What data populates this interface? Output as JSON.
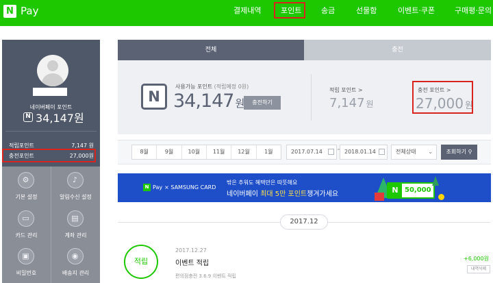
{
  "header": {
    "logo_letter": "N",
    "brand": "Pay",
    "nav": [
      "결제내역",
      "포인트",
      "송금",
      "선물함",
      "이벤트·쿠폰",
      "구매평·문의"
    ],
    "active_nav": "포인트"
  },
  "profile": {
    "point_label": "네이버페이 포인트",
    "total_points": "34,147원",
    "rows": [
      {
        "label": "적립포인트",
        "value": "7,147 원"
      },
      {
        "label": "충전포인트",
        "value": "27,000원"
      }
    ],
    "menu": [
      {
        "label": "기본 설정",
        "icon": "gear-icon"
      },
      {
        "label": "알림수신 설정",
        "icon": "bell-icon"
      },
      {
        "label": "카드 관리",
        "icon": "card-icon"
      },
      {
        "label": "계좌 관리",
        "icon": "bank-icon"
      },
      {
        "label": "비밀번호",
        "icon": "lock-icon"
      },
      {
        "label": "배송지 관리",
        "icon": "location-pin-icon"
      }
    ]
  },
  "tabs": [
    "전체",
    "충전"
  ],
  "summary": {
    "available_label": "사용가능 포인트",
    "available_sub": "(적립예정 0원)",
    "available_value": "34,147",
    "unit": "원",
    "charge_button": "충전하기",
    "accrued_label": "적립 포인트 >",
    "accrued_value": "7,147",
    "charged_label": "충전 포인트 >",
    "charged_value": "27,000"
  },
  "filter": {
    "months": [
      "8월",
      "9월",
      "10월",
      "11월",
      "12월",
      "1월"
    ],
    "date_from": "2017.07.14",
    "date_to": "2018.01.14",
    "tilde": "~",
    "status_select": "전체상태",
    "query_button": "조회하기"
  },
  "banner": {
    "brand": "Pay",
    "partner": "× SAMSUNG CARD",
    "line1": "밖은 추워도 혜택만은 따뜻해요",
    "line2_prefix": "네이버페이 ",
    "line2_highlight": "최대 5만 포인트",
    "line2_suffix": "챙겨가세요",
    "card_amount": "50,000"
  },
  "timeline": {
    "month": "2017.12",
    "tx": {
      "type": "적립",
      "date": "2017.12.27",
      "title": "이벤트 적립",
      "sub": "편의점충전 3.6.9 이벤트 적립",
      "amount": "+6,000원",
      "detail": "내역삭제"
    }
  },
  "colors": {
    "brand_green": "#1ec800",
    "panel_dark": "#4f5869",
    "highlight_red": "#d9231d",
    "banner_blue": "#1e4fc8"
  }
}
